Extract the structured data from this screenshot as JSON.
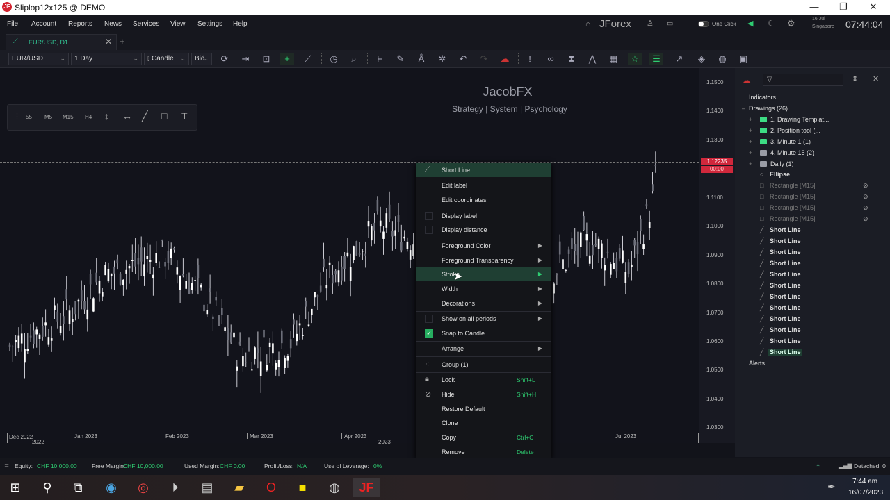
{
  "window": {
    "title": "Sliplop12x125 @ DEMO",
    "logo": "JF"
  },
  "menu": [
    "File",
    "Account",
    "Reports",
    "News",
    "Services",
    "View",
    "Settings",
    "Help"
  ],
  "header": {
    "brand": "JForex",
    "one_click": "One Click",
    "date": "16 Jul",
    "city": "Singapore",
    "time": "07:44:04"
  },
  "tab": {
    "label": "EUR/USD, D1"
  },
  "toolbar": {
    "instrument": "EUR/USD",
    "period": "1 Day",
    "chart_type": "Candle",
    "side": "Bid"
  },
  "chart": {
    "title": "JacobFX",
    "subtitle": "Strategy | System | Psychology",
    "quick_periods": [
      "55",
      "M5",
      "M15",
      "H4"
    ],
    "price_ticks": [
      "1.1500",
      "1.1400",
      "1.1300",
      "1.1100",
      "1.1000",
      "1.0900",
      "1.0800",
      "1.0700",
      "1.0600",
      "1.0500",
      "1.0400",
      "1.0300"
    ],
    "current_price": "1.12235",
    "countdown": "00:00",
    "month_labels": [
      "Dec 2022",
      "Jan 2023",
      "Feb 2023",
      "Mar 2023",
      "Apr 2023",
      "Jul 2023"
    ],
    "year_labels": [
      "2022",
      "2023"
    ]
  },
  "side_panel": {
    "indicators": "Indicators",
    "drawings": "Drawings (26)",
    "folders": [
      {
        "label": "1. Drawing Templat...",
        "color": "#3ddc84"
      },
      {
        "label": "2. Position tool (...",
        "color": "#3ddc84"
      },
      {
        "label": "3. Minute 1 (1)",
        "color": "#3ddc84"
      },
      {
        "label": "4. Minute 15 (2)",
        "color": "#9a9ca6"
      },
      {
        "label": "Daily (1)",
        "color": "#9a9ca6"
      }
    ],
    "ellipse": "Ellipse",
    "rectangles": [
      "Rectangle [M15]",
      "Rectangle [M15]",
      "Rectangle [M15]",
      "Rectangle [M15]"
    ],
    "short_lines": [
      "Short Line",
      "Short Line",
      "Short Line",
      "Short Line",
      "Short Line",
      "Short Line",
      "Short Line",
      "Short Line",
      "Short Line",
      "Short Line",
      "Short Line",
      "Short Line"
    ],
    "alerts": "Alerts"
  },
  "context_menu": {
    "title": "Short Line",
    "edit_label": "Edit label",
    "edit_coordinates": "Edit coordinates",
    "display_label": "Display label",
    "display_distance": "Display distance",
    "fg_color": "Foreground Color",
    "fg_transparency": "Foreground Transparency",
    "stroke": "Stroke",
    "width": "Width",
    "decorations": "Decorations",
    "show_all": "Show on all periods",
    "snap": "Snap to Candle",
    "arrange": "Arrange",
    "group": "Group (1)",
    "lock": "Lock",
    "lock_key": "Shift+L",
    "hide": "Hide",
    "hide_key": "Shift+H",
    "restore": "Restore Default",
    "clone": "Clone",
    "copy": "Copy",
    "copy_key": "Ctrl+C",
    "remove": "Remove",
    "remove_key": "Delete"
  },
  "status": {
    "equity_label": "Equity:",
    "equity": "CHF 10,000.00",
    "free_label": "Free Margin:",
    "free": "CHF 10,000.00",
    "used_label": "Used Margin:",
    "used": "CHF 0.00",
    "pl_label": "Profit/Loss:",
    "pl": "N/A",
    "lev_label": "Use of Leverage:",
    "lev": "0%",
    "detached": "Detached: 0"
  },
  "taskbar": {
    "time": "7:44 am",
    "date": "16/07/2023"
  },
  "colors": {
    "accent": "#2ecc71",
    "price_tag": "#d0283c",
    "highlight": "#1f3f33"
  }
}
